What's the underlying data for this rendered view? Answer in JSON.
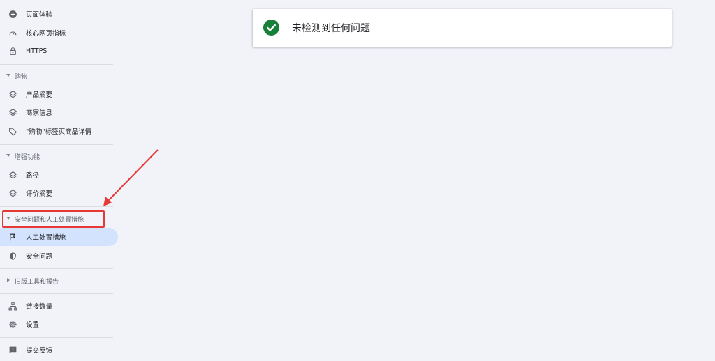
{
  "sidebar": {
    "top_items": [
      {
        "label": "页面体验",
        "icon": "plus-circle-icon"
      },
      {
        "label": "核心网页指标",
        "icon": "speed-gauge-icon"
      },
      {
        "label": "HTTPS",
        "icon": "lock-icon"
      }
    ],
    "shopping": {
      "title": "购物",
      "items": [
        {
          "label": "产品摘要",
          "icon": "layers-icon"
        },
        {
          "label": "商家信息",
          "icon": "layers-icon"
        },
        {
          "label": "\"购物\"标签页商品详情",
          "icon": "tag-icon"
        }
      ]
    },
    "enhancements": {
      "title": "增强功能",
      "items": [
        {
          "label": "路径",
          "icon": "layers-icon"
        },
        {
          "label": "评价摘要",
          "icon": "layers-icon"
        }
      ]
    },
    "security": {
      "title": "安全问题和人工处置措施",
      "items": [
        {
          "label": "人工处置措施",
          "icon": "flag-icon",
          "active": true
        },
        {
          "label": "安全问题",
          "icon": "shield-icon"
        }
      ]
    },
    "legacy": {
      "title": "旧版工具和报告"
    },
    "bottom_items": [
      {
        "label": "链接数量",
        "icon": "sitemap-icon"
      },
      {
        "label": "设置",
        "icon": "gear-icon"
      }
    ],
    "feedback": {
      "label": "提交反馈",
      "icon": "feedback-icon"
    }
  },
  "main": {
    "status_message": "未检测到任何问题",
    "status_icon": "check-circle-icon",
    "status_color": "#188038"
  },
  "colors": {
    "background": "#f1f3f9",
    "active_item": "#d3e3fd",
    "annotation": "#e53935"
  }
}
